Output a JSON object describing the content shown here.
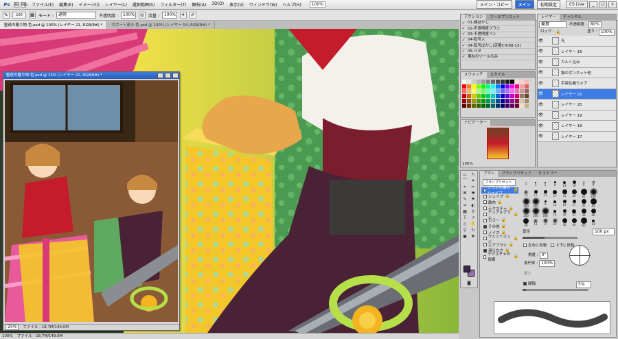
{
  "app": {
    "logo": "Ps"
  },
  "menu": {
    "items": [
      "ファイル(F)",
      "編集(E)",
      "イメージ(I)",
      "レイヤー(L)",
      "選択範囲(S)",
      "フィルター(T)",
      "解析(A)",
      "3D(D)",
      "表示(V)",
      "ウィンドウ(W)",
      "ヘルプ(H)"
    ],
    "zoom": "100%",
    "workspaces": [
      "メイン・コピー",
      "メイン",
      "初期設定"
    ],
    "cs_live": "CS Live"
  },
  "options": {
    "brush_size": "100",
    "mode_label": "モード :",
    "mode_value": "通常",
    "opacity_label": "不透明度 :",
    "opacity_value": "100%",
    "flow_label": "流量 :",
    "flow_value": "100%"
  },
  "doc_tabs": [
    "聖夜の贈り物-色.psd @ 100% (レイヤー 21, RGB/8#) *",
    "ホポート双子-色.psd @ 100% (レイヤー 54, RGB/8#) *"
  ],
  "doc_window": {
    "title": "聖夜の贈り物-色.psd @ 25% (レイヤー 21, RGB/8#) *",
    "zoom": "25%",
    "file_info": "ファイル : 18.7M/149.0M"
  },
  "main_status": {
    "zoom": "100%",
    "file_info": "ファイル : 18.7M/149.0M"
  },
  "actions_panel": {
    "tabs": [
      "アクション",
      "ツールプリセット"
    ],
    "items": [
      "01-線ぼかし",
      "02-不透明度ブラシ",
      "03-不透明度ペン",
      "04-転写入",
      "04-転写ぼかし(定着CH/98-13)",
      "05-ベタ",
      "現在のツールのみ"
    ]
  },
  "swatch_panel": {
    "tabs": [
      "スウォッチ",
      "スタイル"
    ],
    "colors": [
      "#ffffff",
      "#e6e6e6",
      "#cccccc",
      "#b3b3b3",
      "#999999",
      "#808080",
      "#666666",
      "#4d4d4d",
      "#333333",
      "#1a1a1a",
      "#000000",
      "#ffdddd",
      "#ffcccc",
      "#f7b5b5",
      "#ff0000",
      "#ff8000",
      "#ffff00",
      "#80ff00",
      "#00ff00",
      "#00ff80",
      "#00ffff",
      "#0080ff",
      "#0000ff",
      "#8000ff",
      "#ff00ff",
      "#ff0080",
      "#f2a0a0",
      "#e06060",
      "#ff6666",
      "#ffb366",
      "#ffff66",
      "#b3ff66",
      "#66ff66",
      "#66ffb3",
      "#66ffff",
      "#66b3ff",
      "#6666ff",
      "#b366ff",
      "#ff66ff",
      "#ff66b3",
      "#cc9999",
      "#996666",
      "#cc0000",
      "#cc6600",
      "#cccc00",
      "#66cc00",
      "#00cc00",
      "#00cc66",
      "#00cccc",
      "#0066cc",
      "#0000cc",
      "#6600cc",
      "#cc00cc",
      "#cc0066",
      "#997766",
      "#664433",
      "#990000",
      "#994c00",
      "#999900",
      "#4c9900",
      "#009900",
      "#00994c",
      "#009999",
      "#004c99",
      "#000099",
      "#4c0099",
      "#990099",
      "#99004c",
      "#d9c2a6",
      "#a68a6e",
      "#660000",
      "#663300",
      "#666600",
      "#336600",
      "#006600",
      "#006633",
      "#006666",
      "#003366",
      "#000066",
      "#330066",
      "#660066",
      "#660033",
      "#f0e0c8",
      "#c8b090"
    ]
  },
  "navigator_panel": {
    "title": "ナビゲーター",
    "zoom": "100%"
  },
  "layers_panel": {
    "tabs": [
      "レイヤー",
      "チャンネル"
    ],
    "blend_mode": "乗算",
    "opacity_label": "不透明度 :",
    "opacity_value": "80%",
    "lock_label": "ロック :",
    "fill_label": "塗り :",
    "fill_value": "100%",
    "layers": [
      {
        "name": "光",
        "selected": false
      },
      {
        "name": "レイヤー 16",
        "selected": false
      },
      {
        "name": "カルく込み",
        "selected": false
      },
      {
        "name": "猫のボンネット他",
        "selected": false
      },
      {
        "name": "手袋住麗ウォア",
        "selected": false
      },
      {
        "name": "レイヤー 21",
        "selected": true
      },
      {
        "name": "レイヤー 20",
        "selected": false
      },
      {
        "name": "レイヤー 19",
        "selected": false
      },
      {
        "name": "レイヤー 18",
        "selected": false
      },
      {
        "name": "レイヤー 17",
        "selected": false
      }
    ]
  },
  "brush_panel": {
    "tabs": [
      "ブラシ",
      "ブラシプリセット",
      "ヒストリー"
    ],
    "preset_button": "ブラシプリセット",
    "options": [
      {
        "label": "ブラシ先端のシェイプ",
        "checked": false,
        "selected": true
      },
      {
        "label": "シェイプ",
        "checked": false
      },
      {
        "label": "散布",
        "checked": false
      },
      {
        "label": "テクスチャ",
        "checked": false
      },
      {
        "label": "デュアルブラシ",
        "checked": false
      },
      {
        "label": "カラー",
        "checked": false
      },
      {
        "label": "その他",
        "checked": true
      },
      {
        "label": "ノイズ",
        "checked": false
      },
      {
        "label": "ウェットエッジ",
        "checked": false
      },
      {
        "label": "エアブラシ",
        "checked": false
      },
      {
        "label": "滑らかさ",
        "checked": true
      },
      {
        "label": "テクスチャの保護",
        "checked": false
      }
    ],
    "tip_sizes": [
      "1",
      "3",
      "5",
      "9",
      "13",
      "19",
      "5",
      "9",
      "13",
      "17",
      "21",
      "27",
      "35",
      "45",
      "65",
      "100",
      "200",
      "300",
      "9",
      "13",
      "19",
      "17",
      "45",
      "65",
      "100",
      "200",
      "300",
      "14",
      "24",
      "27",
      "39",
      "46",
      "59",
      "11",
      "17",
      "23",
      "36",
      "44",
      "60",
      "14"
    ],
    "diameter_label": "直径",
    "diameter_value": "100 px",
    "flip_x": "左右に反転",
    "flip_y": "上下に反転",
    "angle_label": "角度 :",
    "angle_value": "0°",
    "roundness_label": "真円率 :",
    "roundness_value": "100%",
    "hardness_label": "硬さ",
    "spacing_label": "間隔",
    "spacing_value": "5%"
  },
  "colors": {
    "accent": "#3d7de3",
    "foreground": "#3b2a4a",
    "background": "#9b6fb8"
  }
}
